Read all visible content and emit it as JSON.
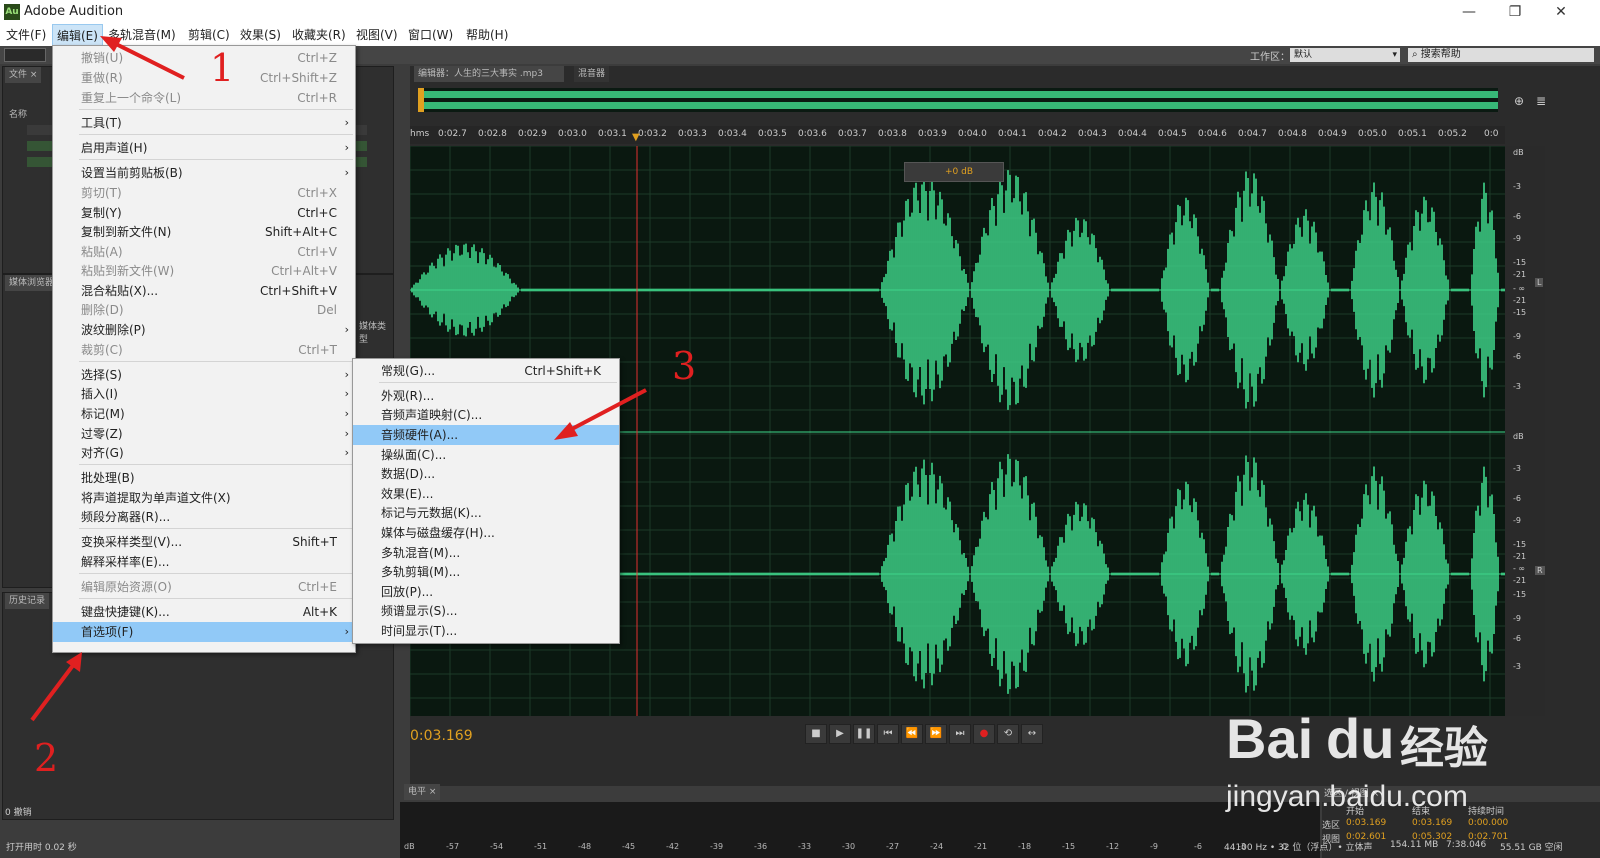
{
  "window": {
    "title": "Adobe Audition",
    "icon": "Au"
  },
  "menubar": [
    {
      "label": "文件(F)"
    },
    {
      "label": "编辑(E)"
    },
    {
      "label": "多轨混音(M)"
    },
    {
      "label": "剪辑(C)"
    },
    {
      "label": "效果(S)"
    },
    {
      "label": "收藏夹(R)"
    },
    {
      "label": "视图(V)"
    },
    {
      "label": "窗口(W)"
    },
    {
      "label": "帮助(H)"
    }
  ],
  "toolbar": {
    "workspace_label": "工作区：",
    "workspace_value": "默认",
    "search_placeholder": "搜索帮助"
  },
  "panels": {
    "files_tab": "文件 ×",
    "name_header": "名称",
    "media_tab": "媒体浏览器",
    "media_type_header": "媒体类型",
    "history_tab": "历史记录",
    "history_undo": "0 撤销",
    "editor_tab": "编辑器：人生的三大事实 .mp3",
    "mixer_tab": "混音器",
    "levels_tab": "电平 ×",
    "selection_tab": "选区 / 视图 ×"
  },
  "hud": {
    "gain": "+0 dB"
  },
  "ruler": {
    "unit": "hms",
    "ticks": [
      "0:02.7",
      "0:02.8",
      "0:02.9",
      "0:03.0",
      "0:03.1",
      "0:03.2",
      "0:03.3",
      "0:03.4",
      "0:03.5",
      "0:03.6",
      "0:03.7",
      "0:03.8",
      "0:03.9",
      "0:04.0",
      "0:04.1",
      "0:04.2",
      "0:04.3",
      "0:04.4",
      "0:04.5",
      "0:04.6",
      "0:04.7",
      "0:04.8",
      "0:04.9",
      "0:05.0",
      "0:05.1",
      "0:05.2",
      "0:0"
    ]
  },
  "db_scale": {
    "top": [
      "dB",
      "-3",
      "-6",
      "-9",
      "-15",
      "-21",
      "- ∞",
      "-21",
      "-15",
      "-9",
      "-6",
      "-3"
    ],
    "bottom": [
      "dB",
      "-3",
      "-6",
      "-9",
      "-15",
      "-21",
      "- ∞",
      "-21",
      "-15",
      "-9",
      "-6",
      "-3"
    ],
    "channel_top": "L",
    "channel_bottom": "R"
  },
  "current_time": "0:03.169",
  "level_scale": [
    "dB",
    "-57",
    "-54",
    "-51",
    "-48",
    "-45",
    "-42",
    "-39",
    "-36",
    "-33",
    "-30",
    "-27",
    "-24",
    "-21",
    "-18",
    "-15",
    "-12",
    "-9",
    "-6",
    "-3",
    "0"
  ],
  "selection": {
    "headers": [
      "开始",
      "结束",
      "持续时间"
    ],
    "rows": [
      {
        "label": "选区",
        "start": "0:03.169",
        "end": "0:03.169",
        "duration": "0:00.000"
      },
      {
        "label": "视图",
        "start": "0:02.601",
        "end": "0:05.302",
        "duration": "0:02.701"
      }
    ]
  },
  "status": {
    "left": "打开用时 0.02 秒",
    "format": "44100 Hz • 32 位（浮点）• 立体声",
    "size": "154.11 MB",
    "duration": "7:38.046",
    "free": "55.51 GB 空闲"
  },
  "edit_menu": {
    "items": [
      {
        "label": "撤销(U)",
        "shortcut": "Ctrl+Z",
        "disabled": true
      },
      {
        "label": "重做(R)",
        "shortcut": "Ctrl+Shift+Z",
        "disabled": true
      },
      {
        "label": "重复上一个命令(L)",
        "shortcut": "Ctrl+R",
        "disabled": true
      },
      {
        "label": "工具(T)",
        "submenu": true
      },
      {
        "label": "启用声道(H)",
        "submenu": true
      },
      {
        "label": "设置当前剪贴板(B)",
        "submenu": true
      },
      {
        "label": "剪切(T)",
        "shortcut": "Ctrl+X",
        "disabled": true
      },
      {
        "label": "复制(Y)",
        "shortcut": "Ctrl+C"
      },
      {
        "label": "复制到新文件(N)",
        "shortcut": "Shift+Alt+C"
      },
      {
        "label": "粘贴(A)",
        "shortcut": "Ctrl+V",
        "disabled": true
      },
      {
        "label": "粘贴到新文件(W)",
        "shortcut": "Ctrl+Alt+V",
        "disabled": true
      },
      {
        "label": "混合粘贴(X)...",
        "shortcut": "Ctrl+Shift+V"
      },
      {
        "label": "删除(D)",
        "shortcut": "Del",
        "disabled": true
      },
      {
        "label": "波纹删除(P)",
        "submenu": true
      },
      {
        "label": "裁剪(C)",
        "shortcut": "Ctrl+T",
        "disabled": true
      },
      {
        "label": "选择(S)",
        "submenu": true
      },
      {
        "label": "插入(I)",
        "submenu": true
      },
      {
        "label": "标记(M)",
        "submenu": true
      },
      {
        "label": "过零(Z)",
        "submenu": true
      },
      {
        "label": "对齐(G)",
        "submenu": true
      },
      {
        "label": "批处理(B)"
      },
      {
        "label": "将声道提取为单声道文件(X)"
      },
      {
        "label": "频段分离器(R)..."
      },
      {
        "label": "变换采样类型(V)...",
        "shortcut": "Shift+T"
      },
      {
        "label": "解释采样率(E)..."
      },
      {
        "label": "编辑原始资源(O)",
        "shortcut": "Ctrl+E",
        "disabled": true
      },
      {
        "label": "键盘快捷键(K)...",
        "shortcut": "Alt+K"
      },
      {
        "label": "首选项(F)",
        "submenu": true,
        "highlighted": true
      }
    ]
  },
  "prefs_menu": {
    "items": [
      {
        "label": "常规(G)...",
        "shortcut": "Ctrl+Shift+K"
      },
      {
        "label": "外观(R)..."
      },
      {
        "label": "音频声道映射(C)..."
      },
      {
        "label": "音频硬件(A)...",
        "highlighted": true
      },
      {
        "label": "操纵面(C)..."
      },
      {
        "label": "数据(D)..."
      },
      {
        "label": "效果(E)..."
      },
      {
        "label": "标记与元数据(K)..."
      },
      {
        "label": "媒体与磁盘缓存(H)..."
      },
      {
        "label": "多轨混音(M)..."
      },
      {
        "label": "多轨剪辑(M)..."
      },
      {
        "label": "回放(P)..."
      },
      {
        "label": "频谱显示(S)..."
      },
      {
        "label": "时间显示(T)..."
      }
    ]
  },
  "annotations": [
    "1",
    "2",
    "3"
  ],
  "watermark": {
    "brand": "Bai",
    "brand2": "du",
    "brand3": "经验",
    "url": "jingyan.baidu.com"
  },
  "colors": {
    "waveform": "#3fd68a",
    "menu_highlight": "#91c9f7",
    "annotation": "#e02020",
    "timecode": "#e0a020"
  }
}
